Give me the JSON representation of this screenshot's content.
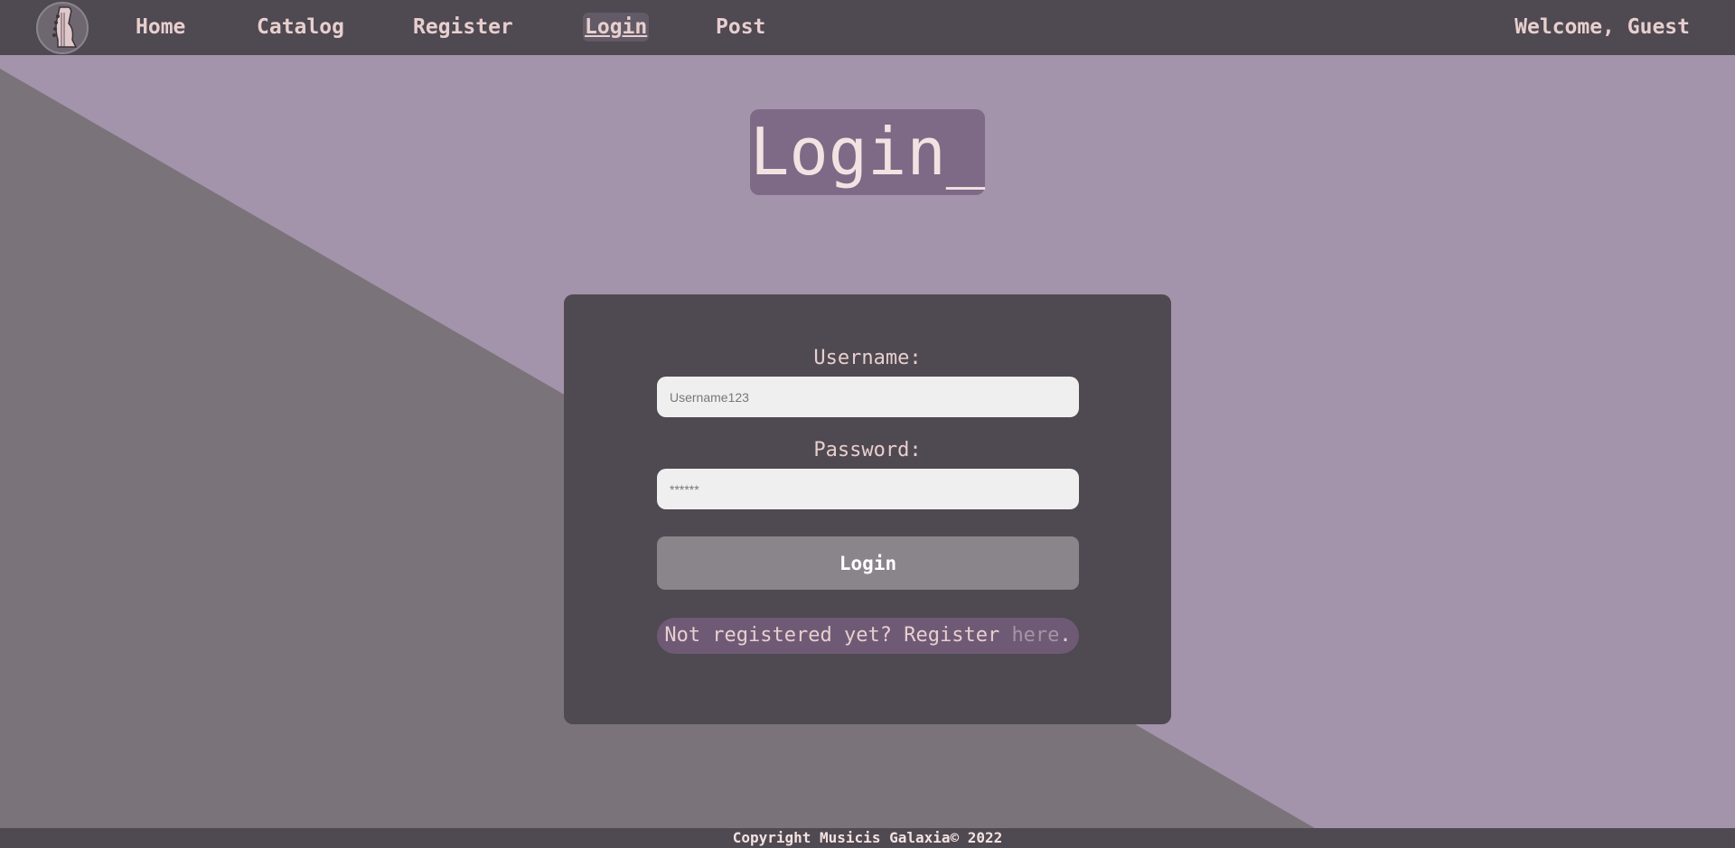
{
  "colors": {
    "navbar": "#4f4951",
    "background_light": "#a393ab",
    "background_dark": "#7a747a",
    "title_bg": "#7e6986",
    "card_bg": "#4f4951",
    "button_bg": "#8a848b",
    "note_bg": "#6f5a76",
    "text_light": "#e8cfcf"
  },
  "nav": {
    "logo_icon": "guitar-headstock-icon",
    "home": "Home",
    "catalog": "Catalog",
    "register": "Register",
    "login": "Login",
    "post": "Post",
    "welcome": "Welcome, Guest"
  },
  "page": {
    "title": "Login_"
  },
  "form": {
    "username_label": "Username:",
    "username_placeholder": "Username123",
    "password_label": "Password:",
    "password_placeholder": "******",
    "login_button": "Login",
    "register_prefix": "Not registered yet? Register ",
    "register_link": "here",
    "register_suffix": "."
  },
  "footer": {
    "text": "Copyright Musicis Galaxia© 2022"
  }
}
